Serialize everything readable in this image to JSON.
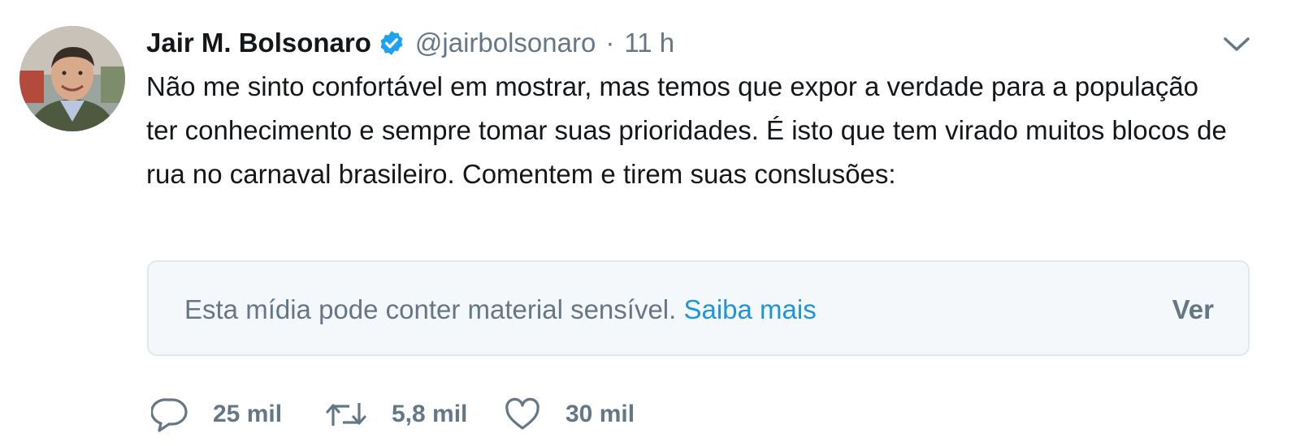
{
  "author": {
    "name": "Jair M. Bolsonaro",
    "handle": "@jairbolsonaro",
    "separator": "·",
    "time": "11 h"
  },
  "tweet": {
    "text": "Não me sinto confortável em mostrar, mas temos que expor a verdade para a população ter conhecimento e sempre tomar suas prioridades. É isto que tem virado muitos blocos de rua no carnaval brasileiro. Comentem e tirem suas conslusões:"
  },
  "media_warning": {
    "message": "Esta mídia pode conter material sensível.",
    "link": "Saiba mais",
    "view_button": "Ver"
  },
  "actions": {
    "replies": "25 mil",
    "retweets": "5,8 mil",
    "likes": "30 mil"
  },
  "icons": {
    "verified": "verified-badge-icon",
    "caret": "chevron-down-icon",
    "reply": "reply-icon",
    "retweet": "retweet-icon",
    "like": "heart-icon"
  },
  "colors": {
    "text": "#14171a",
    "secondary": "#657786",
    "link": "#1b95e0",
    "verified": "#1da1f2",
    "media_bg": "#f5f8fa",
    "border": "#e1e8ed"
  }
}
